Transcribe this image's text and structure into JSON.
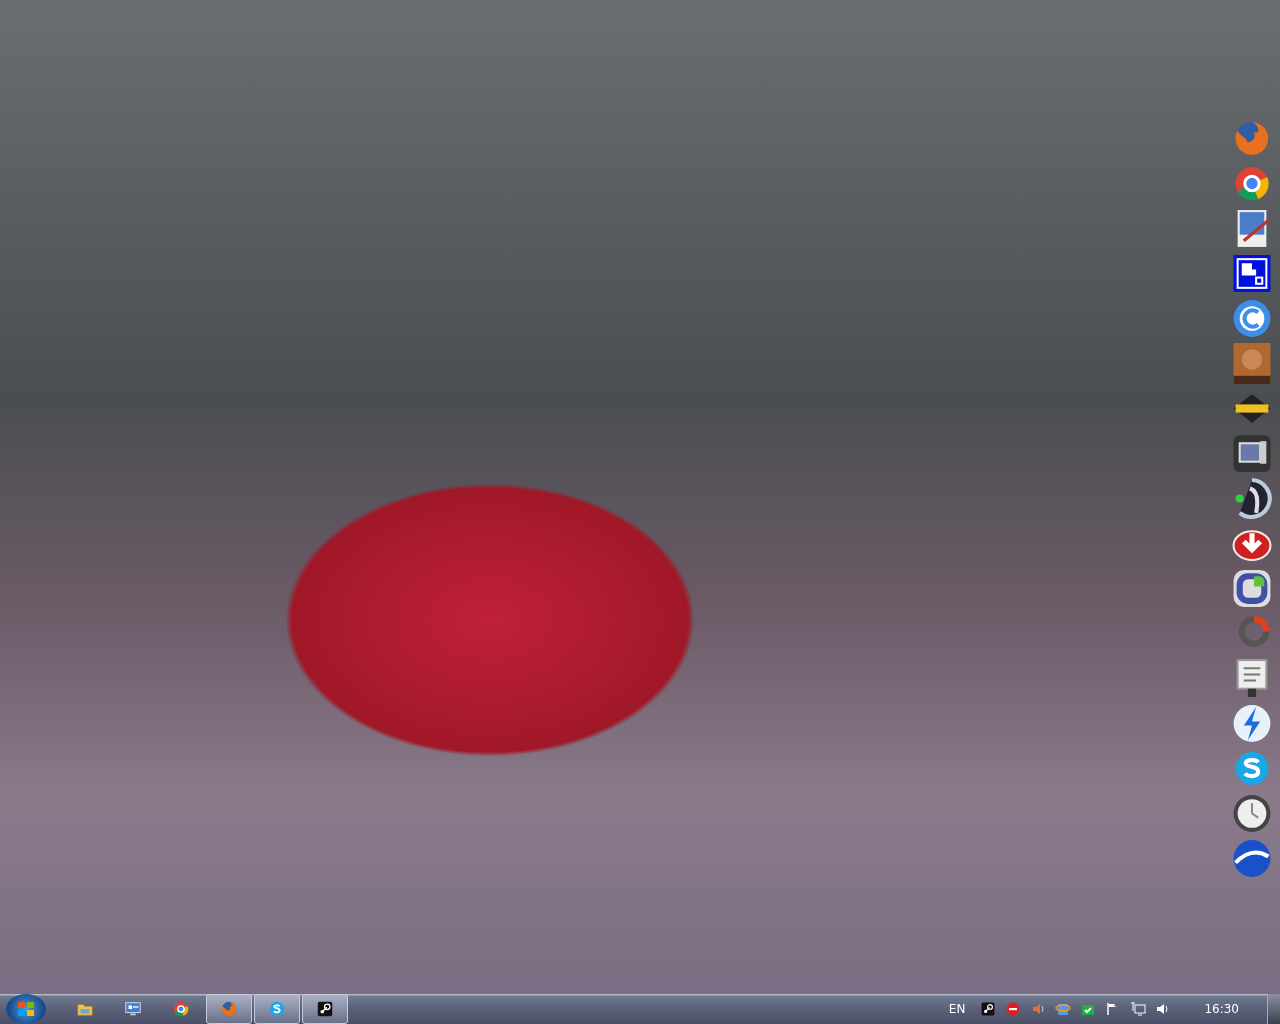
{
  "taskbar": {
    "buttons": [
      {
        "kind": "pinned"
      },
      {
        "kind": "pinned"
      },
      {
        "kind": "pinned"
      },
      {
        "kind": "open"
      },
      {
        "kind": "open"
      },
      {
        "kind": "open"
      }
    ],
    "language": "EN",
    "clock": "16:30"
  }
}
